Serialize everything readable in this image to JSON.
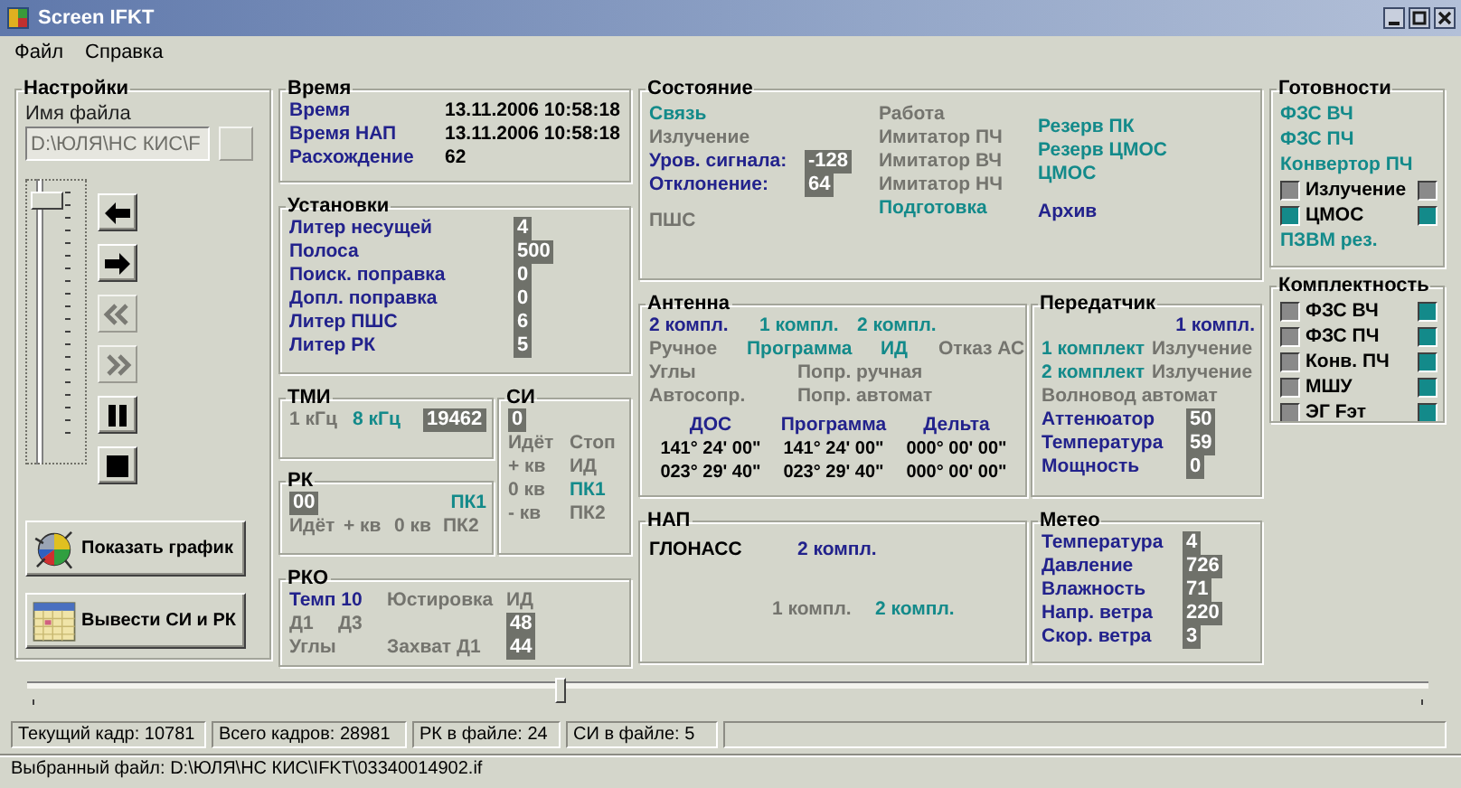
{
  "window": {
    "title": "Screen IFKT"
  },
  "menu": [
    {
      "label": "Файл"
    },
    {
      "label": "Справка"
    }
  ],
  "settings": {
    "title": "Настройки",
    "file_label": "Имя файла",
    "file_field": {
      "value": "D:\\ЮЛЯ\\НС КИС\\F",
      "disabled": true
    },
    "browse_button": {
      "disabled": true
    },
    "frame_slider": {
      "level": 0.93
    },
    "nav_buttons": [
      {
        "disabled": false
      },
      {
        "disabled": false
      },
      {
        "disabled": true
      },
      {
        "disabled": true
      },
      {
        "disabled": false
      },
      {
        "disabled": false
      }
    ],
    "action_buttons": [
      {
        "label": "Показать график"
      },
      {
        "label": "Вывести СИ и РК"
      }
    ]
  },
  "groups": [
    {
      "title": "Время",
      "lines": [
        [
          {
            "text": "Время",
            "color": "#22228c"
          },
          {
            "text": "13.11.2006 10:58:18",
            "color": "#000000"
          }
        ],
        [
          {
            "text": "Время НАП",
            "color": "#22228c"
          },
          {
            "text": "13.11.2006 10:58:18",
            "color": "#000000"
          }
        ],
        [
          {
            "text": "Расхождение",
            "color": "#22228c"
          },
          {
            "text": "62",
            "color": "#000000"
          }
        ]
      ]
    },
    {
      "title": "Установки",
      "lines": [
        [
          {
            "text": "Литер несущей",
            "color": "#22228c"
          },
          {
            "text": "4",
            "color": "#ffffff"
          }
        ],
        [
          {
            "text": "Полоса",
            "color": "#22228c"
          },
          {
            "text": "500",
            "color": "#ffffff"
          }
        ],
        [
          {
            "text": "Поиск. поправка",
            "color": "#22228c"
          },
          {
            "text": "0",
            "color": "#ffffff"
          }
        ],
        [
          {
            "text": "Допл. поправка",
            "color": "#22228c"
          },
          {
            "text": "0",
            "color": "#ffffff"
          }
        ],
        [
          {
            "text": "Литер ПШС",
            "color": "#22228c"
          },
          {
            "text": "6",
            "color": "#ffffff"
          }
        ],
        [
          {
            "text": "Литер РК",
            "color": "#22228c"
          },
          {
            "text": "5",
            "color": "#ffffff"
          }
        ]
      ]
    },
    {
      "title": "ТМИ",
      "lines": [
        [
          {
            "text": "1 кГц",
            "color": "#74746e"
          },
          {
            "text": "8 кГц",
            "color": "#138a8a"
          },
          {
            "text": "19462",
            "color": "#ffffff"
          }
        ]
      ]
    },
    {
      "title": "РК",
      "lines": [
        [
          {
            "text": "00",
            "color": "#ffffff"
          },
          {
            "text": "ПК1",
            "color": "#138a8a"
          }
        ],
        [
          {
            "text": "Идёт",
            "color": "#74746e"
          },
          {
            "text": "+ кв",
            "color": "#74746e"
          },
          {
            "text": "0 кв",
            "color": "#74746e"
          },
          {
            "text": "ПК2",
            "color": "#74746e"
          }
        ]
      ]
    },
    {
      "title": "СИ",
      "lines": [
        [
          {
            "text": "0",
            "color": "#ffffff"
          }
        ],
        [
          {
            "text": "Идёт",
            "color": "#74746e"
          },
          {
            "text": "Стоп",
            "color": "#74746e"
          }
        ],
        [
          {
            "text": "+ кв",
            "color": "#74746e"
          },
          {
            "text": "ИД",
            "color": "#74746e"
          }
        ],
        [
          {
            "text": "0 кв",
            "color": "#74746e"
          },
          {
            "text": "ПК1",
            "color": "#138a8a"
          }
        ],
        [
          {
            "text": "- кв",
            "color": "#74746e"
          },
          {
            "text": "ПК2",
            "color": "#74746e"
          }
        ]
      ]
    },
    {
      "title": "РКО",
      "lines": [
        [
          {
            "text": "Темп 10",
            "color": "#22228c"
          },
          {
            "text": "Юстировка",
            "color": "#74746e"
          },
          {
            "text": "ИД",
            "color": "#74746e"
          }
        ],
        [
          {
            "text": "Д1",
            "color": "#74746e"
          },
          {
            "text": "Д3",
            "color": "#74746e"
          },
          {
            "text": "48",
            "color": "#ffffff"
          }
        ],
        [
          {
            "text": "Углы",
            "color": "#74746e"
          },
          {
            "text": "Захват Д1",
            "color": "#74746e"
          },
          {
            "text": "44",
            "color": "#ffffff"
          }
        ]
      ]
    },
    {
      "title": "Антенна",
      "lines": [
        [
          {
            "text": "2 компл.",
            "color": "#22228c"
          },
          {
            "text": "1 компл.",
            "color": "#138a8a"
          },
          {
            "text": "2 компл.",
            "color": "#138a8a"
          }
        ],
        [
          {
            "text": "Ручное",
            "color": "#74746e"
          },
          {
            "text": "Программа",
            "color": "#138a8a"
          },
          {
            "text": "ИД",
            "color": "#138a8a"
          },
          {
            "text": "Отказ АС",
            "color": "#74746e"
          }
        ],
        [
          {
            "text": "Углы",
            "color": "#74746e"
          },
          {
            "text": "Попр. ручная",
            "color": "#74746e"
          }
        ],
        [
          {
            "text": "Автосопр.",
            "color": "#74746e"
          },
          {
            "text": "Попр. автомат",
            "color": "#74746e"
          }
        ],
        [
          {
            "text": "ДОС",
            "color": "#22228c"
          },
          {
            "text": "Программа",
            "color": "#22228c"
          },
          {
            "text": "Дельта",
            "color": "#22228c"
          }
        ],
        [
          {
            "text": "141° 24' 00\"",
            "color": "#000000"
          },
          {
            "text": "141° 24' 00\"",
            "color": "#000000"
          },
          {
            "text": "000° 00' 00\"",
            "color": "#000000"
          }
        ],
        [
          {
            "text": "023° 29' 40\"",
            "color": "#000000"
          },
          {
            "text": "023° 29' 40\"",
            "color": "#000000"
          },
          {
            "text": "000° 00' 00\"",
            "color": "#000000"
          }
        ]
      ]
    },
    {
      "title": "Передатчик",
      "lines": [
        [
          {
            "text": "1 компл.",
            "color": "#22228c"
          }
        ],
        [
          {
            "text": "1 комплект",
            "color": "#138a8a"
          },
          {
            "text": "Излучение",
            "color": "#74746e"
          }
        ],
        [
          {
            "text": "2 комплект",
            "color": "#138a8a"
          },
          {
            "text": "Излучение",
            "color": "#74746e"
          }
        ],
        [
          {
            "text": "Волновод автомат",
            "color": "#74746e"
          }
        ],
        [
          {
            "text": "Аттенюатор",
            "color": "#22228c"
          },
          {
            "text": "50",
            "color": "#ffffff"
          }
        ],
        [
          {
            "text": "Температура",
            "color": "#22228c"
          },
          {
            "text": "59",
            "color": "#ffffff"
          }
        ],
        [
          {
            "text": "Мощность",
            "color": "#22228c"
          },
          {
            "text": "0",
            "color": "#ffffff"
          }
        ]
      ]
    },
    {
      "title": "НАП",
      "lines": [
        [
          {
            "text": "ГЛОНАСС",
            "color": "#000000"
          },
          {
            "text": "2 компл.",
            "color": "#22228c"
          }
        ],
        [
          {
            "text": "1 компл.",
            "color": "#74746e"
          },
          {
            "text": "2 компл.",
            "color": "#138a8a"
          }
        ]
      ]
    },
    {
      "title": "Метео",
      "lines": [
        [
          {
            "text": "Температура",
            "color": "#22228c"
          },
          {
            "text": "4",
            "color": "#ffffff"
          }
        ],
        [
          {
            "text": "Давление",
            "color": "#22228c"
          },
          {
            "text": "726",
            "color": "#ffffff"
          }
        ],
        [
          {
            "text": "Влажность",
            "color": "#22228c"
          },
          {
            "text": "71",
            "color": "#ffffff"
          }
        ],
        [
          {
            "text": "Напр. ветра",
            "color": "#22228c"
          },
          {
            "text": "220",
            "color": "#ffffff"
          }
        ],
        [
          {
            "text": "Скор. ветра",
            "color": "#22228c"
          },
          {
            "text": "3",
            "color": "#ffffff"
          }
        ]
      ]
    }
  ],
  "state": {
    "title": "Состояние",
    "columns": [
      {
        "lines": [
          [
            {
              "text": "Связь",
              "color": "#138a8a"
            }
          ],
          [
            {
              "text": "Излучение",
              "color": "#74746e"
            }
          ],
          [
            {
              "text": "Уров. сигнала:",
              "color": "#22228c"
            },
            {
              "text": "-128",
              "color": "#ffffff"
            }
          ],
          [
            {
              "text": "Отклонение:",
              "color": "#22228c"
            },
            {
              "text": "64",
              "color": "#ffffff"
            }
          ],
          [
            {
              "text": "ПШС",
              "color": "#74746e"
            }
          ]
        ]
      },
      {
        "lines": [
          [
            {
              "text": "Работа",
              "color": "#74746e"
            }
          ],
          [
            {
              "text": "Имитатор ПЧ",
              "color": "#74746e"
            }
          ],
          [
            {
              "text": "Имитатор ВЧ",
              "color": "#74746e"
            }
          ],
          [
            {
              "text": "Имитатор НЧ",
              "color": "#74746e"
            }
          ],
          [
            {
              "text": "Подготовка",
              "color": "#138a8a"
            }
          ]
        ]
      },
      {
        "lines": [
          [
            {
              "text": "Резерв ПК",
              "color": "#138a8a"
            }
          ],
          [
            {
              "text": "Резерв ЦМОС",
              "color": "#138a8a"
            }
          ],
          [
            {
              "text": "ЦМОС",
              "color": "#138a8a"
            }
          ],
          [
            {
              "text": "Архив",
              "color": "#22228c"
            }
          ]
        ]
      }
    ]
  },
  "readiness": {
    "title": "Готовности",
    "items": [
      {
        "kind": "text",
        "text": "ФЗС ВЧ",
        "color": "#138a8a"
      },
      {
        "kind": "text",
        "text": "ФЗС ПЧ",
        "color": "#138a8a"
      },
      {
        "kind": "text",
        "text": "Конвертор ПЧ",
        "color": "#138a8a"
      },
      {
        "kind": "indicator",
        "text": "Излучение",
        "color": "#000000",
        "indicators": [
          {
            "color": "#8a8a8a"
          },
          {
            "color": "#8a8a8a"
          }
        ]
      },
      {
        "kind": "indicator",
        "text": "ЦМОС",
        "color": "#000000",
        "indicators": [
          {
            "color": "#138a8a"
          },
          {
            "color": "#138a8a"
          }
        ]
      },
      {
        "kind": "text",
        "text": "ПЗВМ рез.",
        "color": "#138a8a"
      }
    ]
  },
  "completeness": {
    "title": "Комплектность",
    "items": [
      {
        "kind": "indicator",
        "text": "ФЗС ВЧ",
        "color": "#000000",
        "indicators": [
          {
            "color": "#8a8a8a"
          },
          {
            "color": "#138a8a"
          }
        ]
      },
      {
        "kind": "indicator",
        "text": "ФЗС ПЧ",
        "color": "#000000",
        "indicators": [
          {
            "color": "#8a8a8a"
          },
          {
            "color": "#138a8a"
          }
        ]
      },
      {
        "kind": "indicator",
        "text": "Конв. ПЧ",
        "color": "#000000",
        "indicators": [
          {
            "color": "#8a8a8a"
          },
          {
            "color": "#138a8a"
          }
        ]
      },
      {
        "kind": "indicator",
        "text": "МШУ",
        "color": "#000000",
        "indicators": [
          {
            "color": "#8a8a8a"
          },
          {
            "color": "#138a8a"
          }
        ]
      },
      {
        "kind": "indicator",
        "text": "ЭГ Fэт",
        "color": "#000000",
        "indicators": [
          {
            "color": "#8a8a8a"
          },
          {
            "color": "#138a8a"
          }
        ]
      }
    ]
  },
  "position_slider": {
    "level": 0.38
  },
  "status_bar": {
    "panels": [
      "Текущий кадр: 10781",
      "Всего кадров: 28981",
      "РК в файле: 24",
      "СИ в файле: 5"
    ],
    "file": "Выбранный файл: D:\\ЮЛЯ\\НС КИС\\IFKT\\03340014902.if"
  }
}
